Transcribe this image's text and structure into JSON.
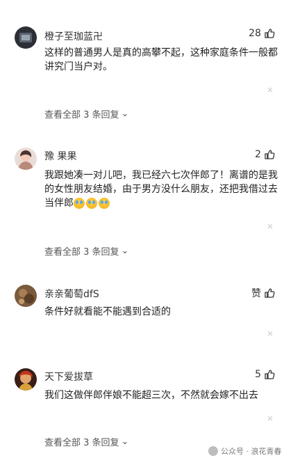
{
  "comments": [
    {
      "username": "橙子至珈蓝卍",
      "likes": "28",
      "text": "这样的普通男人是真的高攀不起，这种家庭条件一般都讲究门当户对。",
      "replies": "查看全部 3 条回复"
    },
    {
      "username": "豫 果果",
      "likes": "2",
      "text": "我跟她凑一对儿吧，我已经六七次伴郎了！离谱的是我的女性朋友结婚，由于男方没什么朋友，还把我借过去当伴郎",
      "emojis": [
        "crying-face-emoji",
        "crying-face-emoji",
        "crying-face-emoji"
      ],
      "replies": "查看全部 3 条回复"
    },
    {
      "username": "亲亲葡萄dfS",
      "likes": "赞",
      "text": "条件好就看能不能遇到合适的"
    },
    {
      "username": "天下爱拔草",
      "likes": "5",
      "text": "我们这做伴郎伴娘不能超三次，不然就会嫁不出去",
      "replies": "查看全部 3 条回复"
    }
  ],
  "close_icon": "×",
  "chevron": "⌄",
  "watermark": {
    "text": "公众号 · 浪花青春"
  },
  "colors": {
    "text": "#222222",
    "muted": "#555555",
    "close": "#c8c8c8"
  }
}
